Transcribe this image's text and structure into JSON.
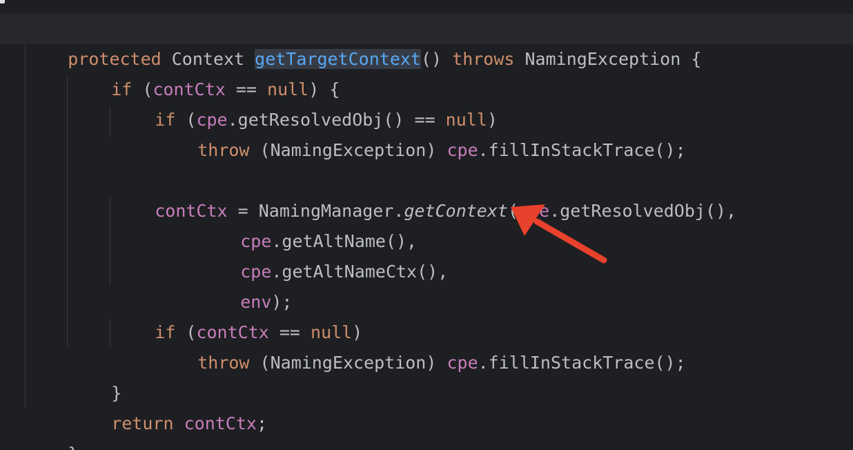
{
  "theme": {
    "background": "#1e1f22",
    "keyword": "#cf8e6d",
    "field": "#c77dbb",
    "method_highlight": "#56a8f5",
    "text": "#bcbec4",
    "annotation_arrow": "#e8412c"
  },
  "code": {
    "l1": {
      "a": "protected",
      "b": " Context ",
      "c": "getTargetContext",
      "d": "() ",
      "e": "throws",
      "f": " NamingException {"
    },
    "l2": {
      "a": "if",
      "b": " (",
      "c": "contCtx",
      "d": " == ",
      "e": "null",
      "f": ") {"
    },
    "l3": {
      "a": "if",
      "b": " (",
      "c": "cpe",
      "d": ".getResolvedObj() == ",
      "e": "null",
      "f": ")"
    },
    "l4": {
      "a": "throw",
      "b": " (NamingException) ",
      "c": "cpe",
      "d": ".fillInStackTrace();"
    },
    "l6": {
      "a": "contCtx",
      "b": " = NamingManager.",
      "c": "getContext",
      "d": "(",
      "e": "cpe",
      "f": ".getResolvedObj(),"
    },
    "l7": {
      "a": "cpe",
      "b": ".getAltName(),"
    },
    "l8": {
      "a": "cpe",
      "b": ".getAltNameCtx(),"
    },
    "l9": {
      "a": "env",
      "b": ");"
    },
    "l10": {
      "a": "if",
      "b": " (",
      "c": "contCtx",
      "d": " == ",
      "e": "null",
      "f": ")"
    },
    "l11": {
      "a": "throw",
      "b": " (NamingException) ",
      "c": "cpe",
      "d": ".fillInStackTrace();"
    },
    "l12": {
      "a": "}"
    },
    "l13": {
      "a": "return",
      "b": " ",
      "c": "contCtx",
      "d": ";"
    },
    "l14": {
      "a": "}"
    }
  }
}
